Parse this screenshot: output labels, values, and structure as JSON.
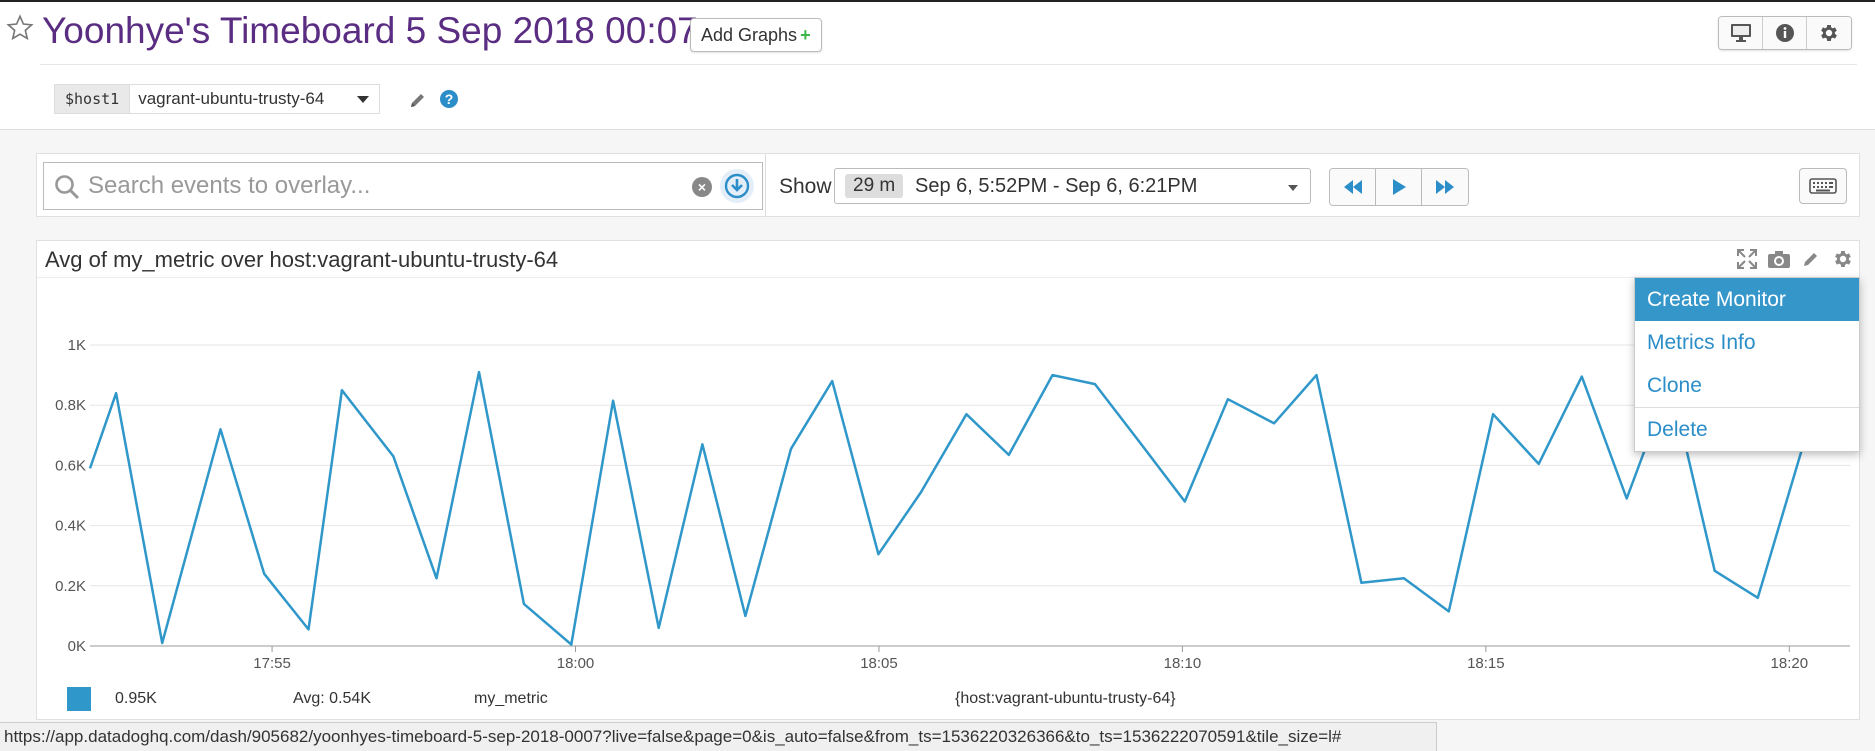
{
  "header": {
    "title": "Yoonhye's Timeboard 5 Sep 2018 00:07",
    "add_graphs_label": "Add Graphs",
    "add_graphs_plus": "+",
    "icons": [
      "monitor-icon",
      "info-icon",
      "gear-icon"
    ]
  },
  "template_var": {
    "name": "$host1",
    "value": "vagrant-ubuntu-trusty-64"
  },
  "toolbar": {
    "search_placeholder": "Search events to overlay...",
    "search_value": "",
    "show_label": "Show",
    "time_chip": "29 m",
    "time_range": "Sep 6, 5:52PM - Sep 6, 6:21PM"
  },
  "widget": {
    "title": "Avg of my_metric over host:vagrant-ubuntu-trusty-64",
    "legend": {
      "current": "0.95K",
      "avg": "Avg: 0.54K",
      "metric": "my_metric",
      "scope": "{host:vagrant-ubuntu-trusty-64}"
    }
  },
  "menu": {
    "items": [
      "Create Monitor",
      "Metrics Info",
      "Clone",
      "Delete"
    ],
    "active_index": 0
  },
  "status_url": "https://app.datadoghq.com/dash/905682/yoonhyes-timeboard-5-sep-2018-0007?live=false&page=0&is_auto=false&from_ts=1536220326366&to_ts=1536222070591&tile_size=l#",
  "colors": {
    "series": "#2f97c9",
    "title": "#5a2d82",
    "accent": "#2c8ec9"
  },
  "chart_data": {
    "type": "line",
    "title": "Avg of my_metric over host:vagrant-ubuntu-trusty-64",
    "xlabel": "",
    "ylabel": "",
    "ylim": [
      0,
      1000
    ],
    "xlim": [
      "17:52",
      "18:21"
    ],
    "x_tick_labels": [
      "17:55",
      "18:00",
      "18:05",
      "18:10",
      "18:15",
      "18:20"
    ],
    "y_tick_labels": [
      "0K",
      "0.2K",
      "0.4K",
      "0.6K",
      "0.8K",
      "1K"
    ],
    "grid": true,
    "series": [
      {
        "name": "my_metric",
        "x_minutes": [
          0,
          0.43,
          1.19,
          2.15,
          2.87,
          3.6,
          4.15,
          5.0,
          5.71,
          6.41,
          7.15,
          7.93,
          8.62,
          9.37,
          10.09,
          10.8,
          11.55,
          12.23,
          12.99,
          13.69,
          14.44,
          15.14,
          15.86,
          16.56,
          17.34,
          18.04,
          18.75,
          19.51,
          20.21,
          20.95,
          21.65,
          22.39,
          23.12,
          23.87,
          24.58,
          25.32,
          26.04,
          26.77,
          27.48,
          28.21,
          28.95
        ],
        "values": [
          590,
          840,
          10,
          720,
          240,
          55,
          850,
          630,
          225,
          910,
          140,
          5,
          815,
          60,
          670,
          100,
          655,
          880,
          305,
          510,
          770,
          635,
          900,
          870,
          665,
          480,
          820,
          740,
          900,
          210,
          225,
          115,
          770,
          605,
          895,
          490,
          880,
          250,
          160,
          655,
          950
        ]
      }
    ]
  }
}
